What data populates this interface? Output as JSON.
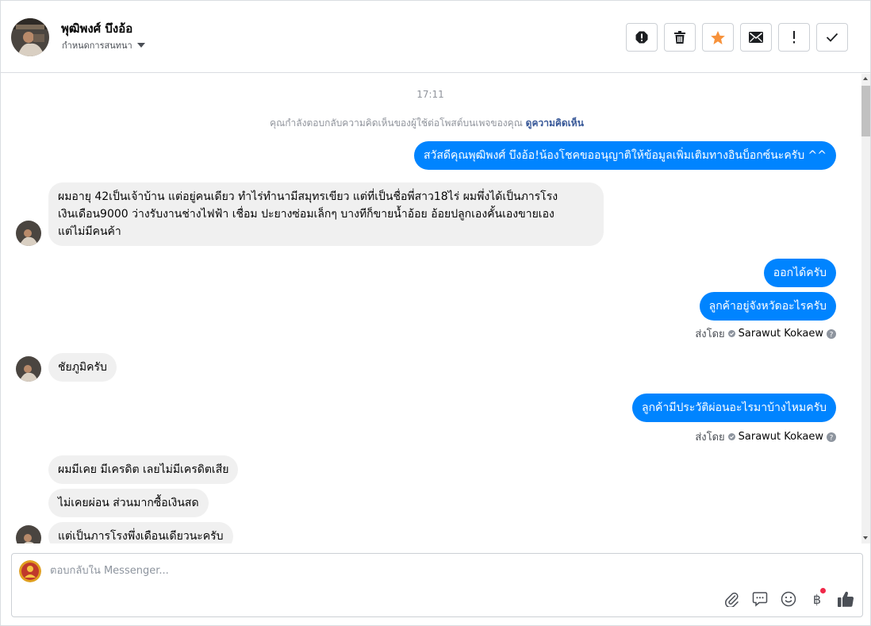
{
  "header": {
    "name": "พุฒิพงศ์ บึงอ้อ",
    "assign_label": "กำหนดการสนทนา",
    "actions": [
      "spam-icon",
      "trash-icon",
      "star-icon",
      "envelope-icon",
      "exclamation-icon",
      "check-icon"
    ]
  },
  "chat": {
    "time": "17:11",
    "notice_text": "คุณกำลังตอบกลับความคิดเห็นของผู้ใช้ต่อโพสต์บนเพจของคุณ",
    "notice_link": "ดูความคิดเห็น",
    "messages": {
      "m1": "สวัสดีคุณพุฒิพงศ์ บึงอ้อ!น้องโชคขออนุญาติให้ข้อมูลเพิ่มเติมทางอินบ็อกซ์นะครับ ^^",
      "m2_line1": "ผมอายุ 42เป็นเจ้าบ้าน แต่อยู่คนเดียว ทำไร่ทำนามีสมุทรเขียว แต่ที่เป็นชื่อพี่สาว18ไร่ ผมพึ่งได้เป็นภารโรง",
      "m2_line2": "เงินเดือน9000 ว่างรับงานช่างไฟฟ้า เชื่อม ปะยางซ่อมเล็กๆ บางทีก็ขายน้ำอ้อย อ้อยปลูกเองคั้นเองขายเอง",
      "m2_line3": "แต่ไม่มีคนค้า",
      "m3": "ออกได้ครับ",
      "m4": "ลูกค้าอยู่จังหวัดอะไรครับ",
      "m5": "ชัยภูมิครับ",
      "m6": "ลูกค้ามีประวัติผ่อนอะไรมาบ้างไหมครับ",
      "m7": "ผมมีเคย มีเครดิต เลยไม่มีเครดิตเสีย",
      "m8": "ไม่เคยผ่อน ส่วนมากซื้อเงินสด",
      "m9": "แต่เป็นภารโรงพึ่งเดือนเดียวนะครับ"
    },
    "sent_by_label": "ส่งโดย",
    "sender_name": "Sarawut Kokaew"
  },
  "composer": {
    "placeholder": "ตอบกลับใน Messenger...",
    "tools": [
      "paperclip-icon",
      "saved-reply-icon",
      "emoji-icon",
      "baht-icon",
      "thumbs-up-icon"
    ],
    "baht_symbol": "฿"
  },
  "colors": {
    "outgoing": "#0084ff",
    "incoming": "#f0f0f0",
    "star": "#f7923b",
    "link": "#385898"
  }
}
